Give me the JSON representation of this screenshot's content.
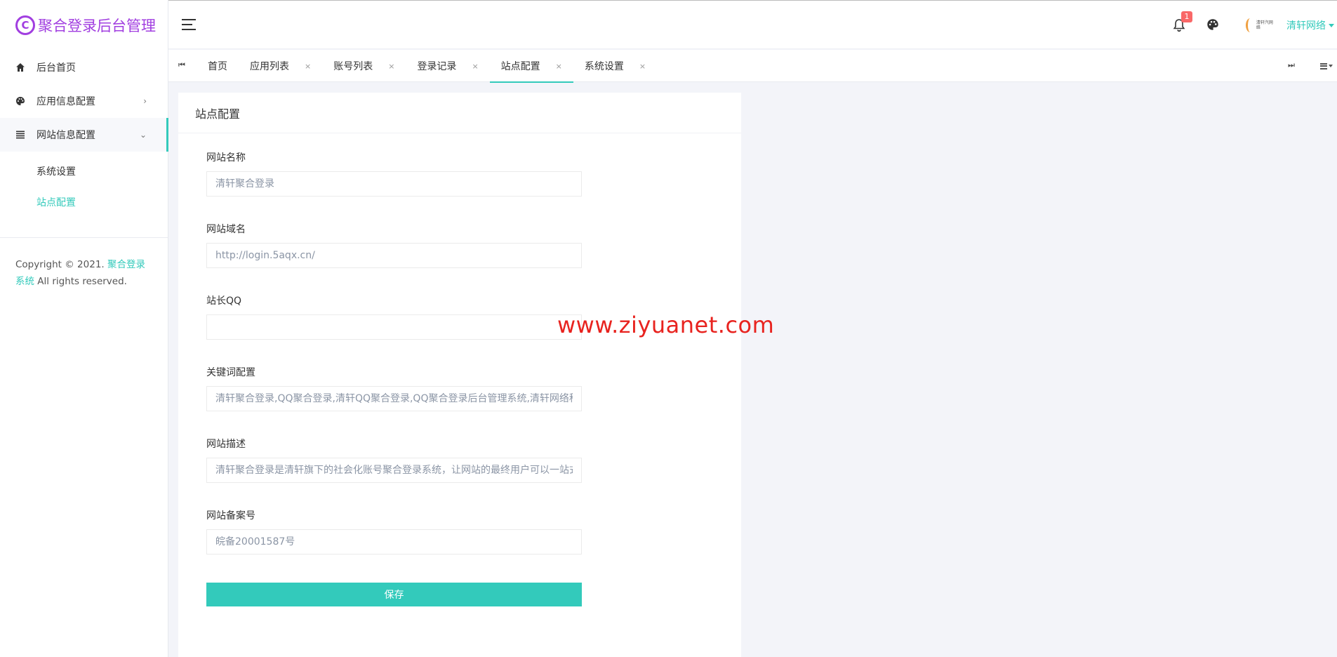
{
  "brand": {
    "logo_letter": "C",
    "title": "聚合登录后台管理",
    "color": "#a13ee0"
  },
  "accent_color": "#33cabb",
  "sidebar": {
    "items": [
      {
        "label": "后台首页",
        "icon": "home-icon",
        "arrow": ""
      },
      {
        "label": "应用信息配置",
        "icon": "palette-icon",
        "arrow": "›"
      },
      {
        "label": "网站信息配置",
        "icon": "list-icon",
        "arrow": "⌄"
      }
    ],
    "submenu": [
      {
        "label": "系统设置"
      },
      {
        "label": "站点配置"
      }
    ],
    "copyright": {
      "prefix": "Copyright © 2021. ",
      "link": "聚合登录系统",
      "suffix": " All rights reserved."
    }
  },
  "header": {
    "notification_count": "1",
    "avatar_text": "清轩汽网络",
    "user_name": "清轩网络"
  },
  "tabs": {
    "nav_left": "⏮",
    "nav_right": "⏭",
    "items": [
      {
        "label": "首页",
        "closable": false
      },
      {
        "label": "应用列表",
        "close": "×"
      },
      {
        "label": "账号列表",
        "close": "×"
      },
      {
        "label": "登录记录",
        "close": "×"
      },
      {
        "label": "站点配置",
        "close": "×"
      },
      {
        "label": "系统设置",
        "close": "×"
      }
    ]
  },
  "card": {
    "title": "站点配置",
    "fields": [
      {
        "label": "网站名称",
        "placeholder": "清轩聚合登录",
        "value": ""
      },
      {
        "label": "网站域名",
        "placeholder": "http://login.5aqx.cn/",
        "value": ""
      },
      {
        "label": "站长QQ",
        "placeholder": "",
        "value": ""
      },
      {
        "label": "关键词配置",
        "placeholder": "清轩聚合登录,QQ聚合登录,清轩QQ聚合登录,QQ聚合登录后台管理系统,清轩网络科技",
        "value": ""
      },
      {
        "label": "网站描述",
        "placeholder": "清轩聚合登录是清轩旗下的社会化账号聚合登录系统，让网站的最终用户可以一站式登录",
        "value": ""
      },
      {
        "label": "网站备案号",
        "placeholder": "皖备20001587号",
        "value": ""
      }
    ],
    "save_label": "保存"
  },
  "watermark": "www.ziyuanet.com"
}
